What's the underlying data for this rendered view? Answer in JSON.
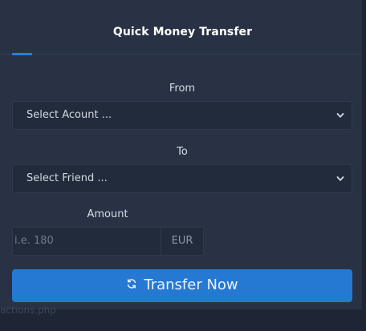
{
  "card": {
    "title": "Quick Money Transfer"
  },
  "from": {
    "label": "From",
    "selected": "Select Acount ..."
  },
  "to": {
    "label": "To",
    "selected": "Select Friend ..."
  },
  "amount": {
    "label": "Amount",
    "placeholder": "i.e. 180",
    "currency": "EUR"
  },
  "transfer_button": {
    "label": "Transfer Now",
    "icon": "refresh-icon"
  },
  "footer": {
    "link_text": "actions.php"
  },
  "colors": {
    "accent": "#2b7be3",
    "button": "#2679d3",
    "card": "#283244",
    "background": "#1e2535"
  }
}
